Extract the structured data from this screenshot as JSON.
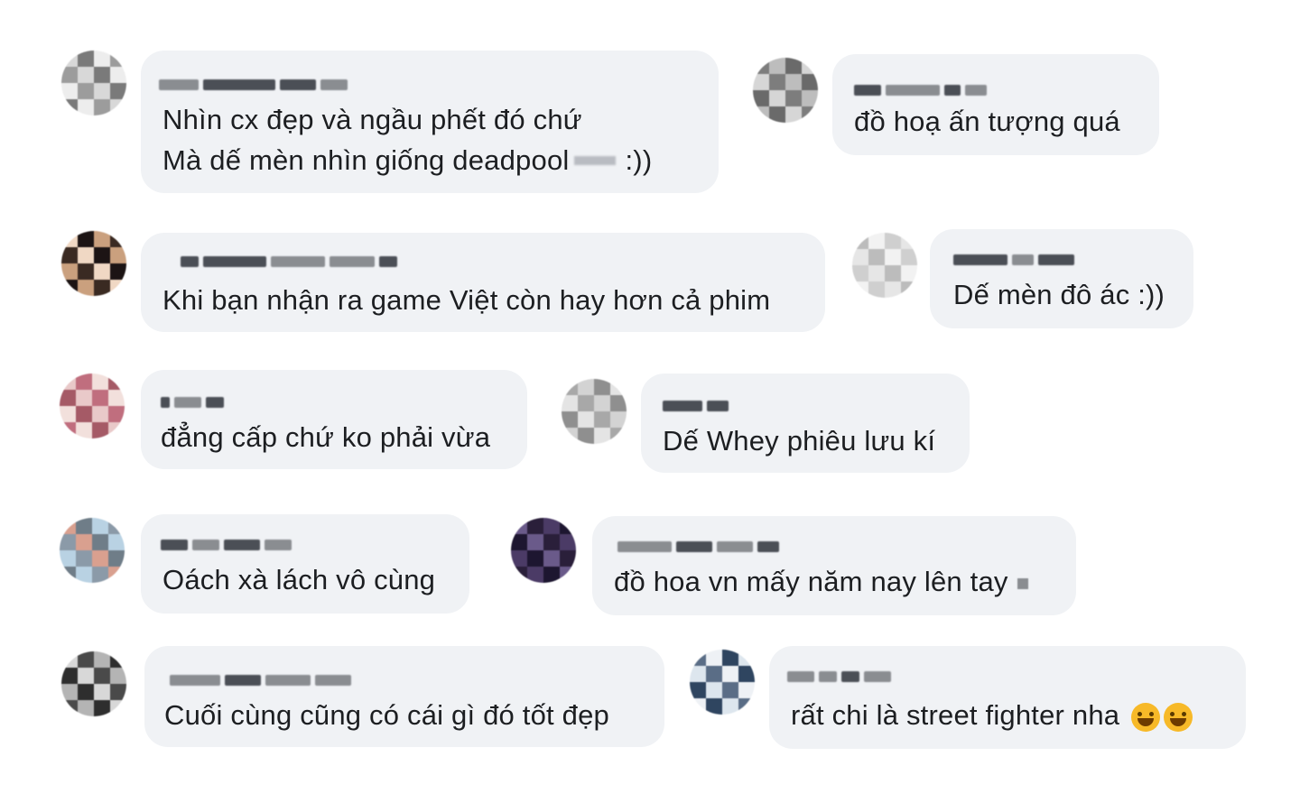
{
  "comments": [
    {
      "lines": [
        "Nhìn cx đẹp và ngầu phết đó chứ",
        "Mà dế mèn nhìn giống deadpool",
        ":))"
      ],
      "avatar_colors": [
        "#d8d8d8",
        "#7a7a7a",
        "#ededed",
        "#9c9c9c"
      ]
    },
    {
      "lines": [
        "đồ hoạ ấn tượng quá"
      ],
      "avatar_colors": [
        "#d6d6d6",
        "#7d7d7d",
        "#bdbdbd",
        "#6a6a6a"
      ]
    },
    {
      "lines": [
        "Khi bạn nhận ra game Việt còn hay hơn cả phim"
      ],
      "avatar_colors": [
        "#caa07e",
        "#3a2a22",
        "#f0d8c4",
        "#1c1414"
      ]
    },
    {
      "lines": [
        "Dế mèn đô ác :))"
      ],
      "avatar_colors": [
        "#f2f2f2",
        "#cfcfcf",
        "#e6e6e6",
        "#bcbcbc"
      ]
    },
    {
      "lines": [
        "đẳng cấp chứ ko phải vừa"
      ],
      "avatar_colors": [
        "#e9c9c9",
        "#c06e7e",
        "#f2e0dc",
        "#a55a66"
      ]
    },
    {
      "lines": [
        "Dế Whey phiêu lưu kí"
      ],
      "avatar_colors": [
        "#e4e4e4",
        "#a8a8a8",
        "#d3d3d3",
        "#8f8f8f"
      ]
    },
    {
      "lines": [
        "Oách xà lách vô cùng"
      ],
      "avatar_colors": [
        "#b9d2e3",
        "#8b9aa8",
        "#d9a08f",
        "#6f7d88"
      ]
    },
    {
      "lines": [
        "đồ hoa vn mấy năm nay lên tay"
      ],
      "avatar_colors": [
        "#2a1f3a",
        "#4b3b66",
        "#1d1630",
        "#6a5a8a"
      ]
    },
    {
      "lines": [
        "Cuối cùng cũng có cái gì đó tốt đẹp"
      ],
      "avatar_colors": [
        "#d8d8d8",
        "#4a4a4a",
        "#b4b4b4",
        "#2e2e2e"
      ]
    },
    {
      "lines": [
        "rất chi là street fighter nha"
      ],
      "avatar_colors": [
        "#dde6ee",
        "#5a6d86",
        "#eef1f5",
        "#2f4560"
      ]
    }
  ]
}
